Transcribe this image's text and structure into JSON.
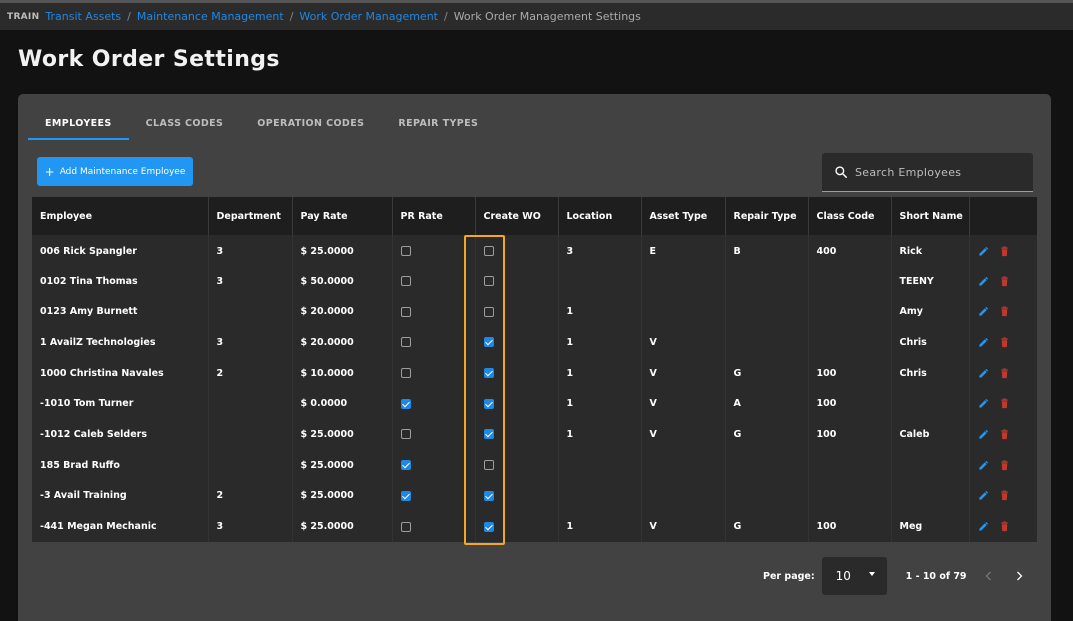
{
  "breadcrumb": {
    "env": "TRAIN",
    "items": [
      "Transit Assets",
      "Maintenance Management",
      "Work Order Management"
    ],
    "current": "Work Order Management Settings"
  },
  "page_title": "Work Order Settings",
  "tabs": [
    "EMPLOYEES",
    "CLASS CODES",
    "OPERATION CODES",
    "REPAIR TYPES"
  ],
  "active_tab": "EMPLOYEES",
  "add_button": {
    "icon": "plus-icon",
    "label": "Add Maintenance Employee"
  },
  "search": {
    "icon": "search-icon",
    "placeholder": "Search Employees",
    "value": ""
  },
  "table": {
    "columns": [
      "Employee",
      "Department",
      "Pay Rate",
      "PR Rate",
      "Create WO",
      "Location",
      "Asset Type",
      "Repair Type",
      "Class Code",
      "Short Name"
    ],
    "rows": [
      {
        "employee": "006 Rick Spangler",
        "department": "3",
        "pay_rate": "$ 25.0000",
        "pr_rate": false,
        "create_wo": false,
        "location": "3",
        "asset_type": "E",
        "repair_type": "B",
        "class_code": "400",
        "short_name": "Rick"
      },
      {
        "employee": "0102 Tina Thomas",
        "department": "3",
        "pay_rate": "$ 50.0000",
        "pr_rate": false,
        "create_wo": false,
        "location": "",
        "asset_type": "",
        "repair_type": "",
        "class_code": "",
        "short_name": "TEENY"
      },
      {
        "employee": "0123 Amy Burnett",
        "department": "",
        "pay_rate": "$ 20.0000",
        "pr_rate": false,
        "create_wo": false,
        "location": "1",
        "asset_type": "",
        "repair_type": "",
        "class_code": "",
        "short_name": "Amy"
      },
      {
        "employee": "1 AvailZ Technologies",
        "department": "3",
        "pay_rate": "$ 20.0000",
        "pr_rate": false,
        "create_wo": true,
        "location": "1",
        "asset_type": "V",
        "repair_type": "",
        "class_code": "",
        "short_name": "Chris"
      },
      {
        "employee": "1000 Christina Navales",
        "department": "2",
        "pay_rate": "$ 10.0000",
        "pr_rate": false,
        "create_wo": true,
        "location": "1",
        "asset_type": "V",
        "repair_type": "G",
        "class_code": "100",
        "short_name": "Chris"
      },
      {
        "employee": "-1010 Tom Turner",
        "department": "",
        "pay_rate": "$ 0.0000",
        "pr_rate": true,
        "create_wo": true,
        "location": "1",
        "asset_type": "V",
        "repair_type": "A",
        "class_code": "100",
        "short_name": ""
      },
      {
        "employee": "-1012 Caleb Selders",
        "department": "",
        "pay_rate": "$ 25.0000",
        "pr_rate": false,
        "create_wo": true,
        "location": "1",
        "asset_type": "V",
        "repair_type": "G",
        "class_code": "100",
        "short_name": "Caleb"
      },
      {
        "employee": "185 Brad Ruffo",
        "department": "",
        "pay_rate": "$ 25.0000",
        "pr_rate": true,
        "create_wo": false,
        "location": "",
        "asset_type": "",
        "repair_type": "",
        "class_code": "",
        "short_name": ""
      },
      {
        "employee": "-3 Avail Training",
        "department": "2",
        "pay_rate": "$ 25.0000",
        "pr_rate": true,
        "create_wo": true,
        "location": "",
        "asset_type": "",
        "repair_type": "",
        "class_code": "",
        "short_name": ""
      },
      {
        "employee": "-441 Megan Mechanic",
        "department": "3",
        "pay_rate": "$ 25.0000",
        "pr_rate": false,
        "create_wo": true,
        "location": "1",
        "asset_type": "V",
        "repair_type": "G",
        "class_code": "100",
        "short_name": "Meg"
      }
    ],
    "row_actions": [
      "edit-icon",
      "delete-icon"
    ]
  },
  "pagination": {
    "per_page_label": "Per page:",
    "per_page_value": "10",
    "range": "1 - 10 of 79"
  },
  "colors": {
    "accent": "#2196f3",
    "highlight": "#f5a623",
    "delete": "#c0392b"
  }
}
